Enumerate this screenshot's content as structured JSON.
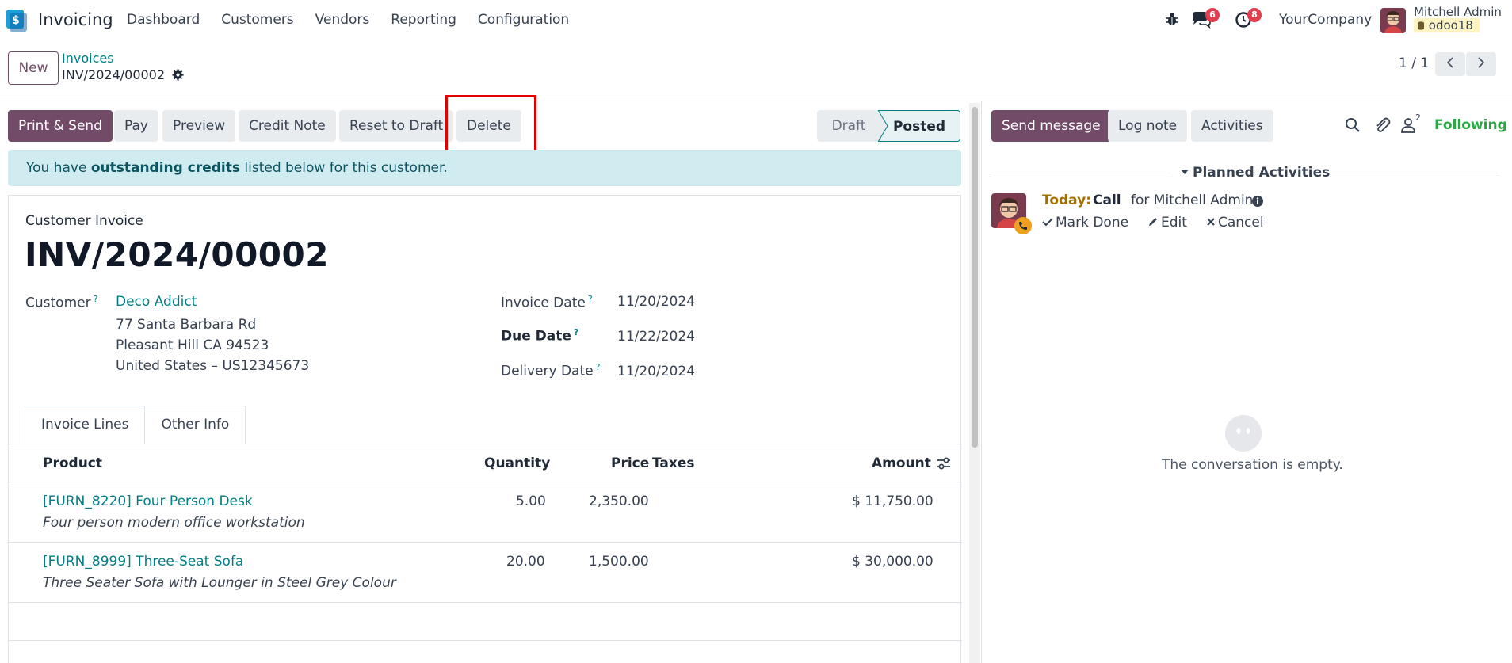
{
  "navbar": {
    "app_name": "Invoicing",
    "menu": [
      "Dashboard",
      "Customers",
      "Vendors",
      "Reporting",
      "Configuration"
    ],
    "messages_badge": "6",
    "activities_badge": "8",
    "company": "YourCompany",
    "user_name": "Mitchell Admin",
    "db_name": "odoo18"
  },
  "control_panel": {
    "new_label": "New",
    "breadcrumb_parent": "Invoices",
    "breadcrumb_current": "INV/2024/00002",
    "pager_value": "1 / 1"
  },
  "actions": {
    "print_send": "Print & Send",
    "pay": "Pay",
    "preview": "Preview",
    "credit_note": "Credit Note",
    "reset_to_draft": "Reset to Draft",
    "delete": "Delete"
  },
  "status": {
    "draft": "Draft",
    "posted": "Posted",
    "current": "Posted"
  },
  "alert": {
    "prefix": "You have ",
    "bold": "outstanding credits",
    "suffix": " listed below for this customer."
  },
  "invoice": {
    "doc_type": "Customer Invoice",
    "number": "INV/2024/00002",
    "customer_label": "Customer",
    "customer_name": "Deco Addict",
    "address_lines": [
      "77 Santa Barbara Rd",
      "Pleasant Hill CA 94523",
      "United States – US12345673"
    ],
    "invoice_date_label": "Invoice Date",
    "invoice_date": "11/20/2024",
    "due_date_label": "Due Date",
    "due_date": "11/22/2024",
    "delivery_date_label": "Delivery Date",
    "delivery_date": "11/20/2024",
    "help_mark": "?"
  },
  "tabs": [
    "Invoice Lines",
    "Other Info"
  ],
  "table": {
    "headers": {
      "product": "Product",
      "quantity": "Quantity",
      "price": "Price",
      "taxes": "Taxes",
      "amount": "Amount"
    },
    "rows": [
      {
        "product": "[FURN_8220] Four Person Desk",
        "description": "Four person modern office workstation",
        "quantity": "5.00",
        "price": "2,350.00",
        "amount": "$ 11,750.00"
      },
      {
        "product": "[FURN_8999] Three-Seat Sofa",
        "description": "Three Seater Sofa with Lounger in Steel Grey Colour",
        "quantity": "20.00",
        "price": "1,500.00",
        "amount": "$ 30,000.00"
      }
    ]
  },
  "chatter": {
    "send_message": "Send message",
    "log_note": "Log note",
    "activities": "Activities",
    "follower_count": "2",
    "following": "Following",
    "planned_title": "Planned Activities",
    "activity": {
      "today": "Today:",
      "type": "Call",
      "for": "for Mitchell Admin",
      "mark_done": "Mark Done",
      "edit": "Edit",
      "cancel": "Cancel"
    },
    "empty_text": "The conversation is empty."
  },
  "colors": {
    "primary": "#714b67",
    "link": "#017e84",
    "alert_bg": "#d1ecf1",
    "highlight": "#e00000",
    "following": "#28a745"
  }
}
